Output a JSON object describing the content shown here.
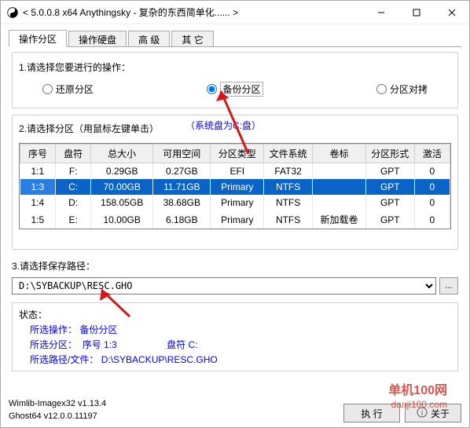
{
  "window": {
    "title": "< 5.0.0.8 x64 Anythingsky - 复杂的东西简单化...... >"
  },
  "tabs": {
    "t0": "操作分区",
    "t1": "操作硬盘",
    "t2": "高 级",
    "t3": "其 它"
  },
  "section1": {
    "label": "1.请选择您要进行的操作：",
    "opt_restore": "还原分区",
    "opt_backup": "备份分区",
    "opt_copy": "分区对拷"
  },
  "section2": {
    "label": "2.请选择分区（用鼠标左键单击）",
    "sysdisk": "（系统盘为C:盘）",
    "headers": {
      "idx": "序号",
      "drv": "盘符",
      "total": "总大小",
      "free": "可用空间",
      "type": "分区类型",
      "fs": "文件系统",
      "vol": "卷标",
      "scheme": "分区形式",
      "act": "激活"
    },
    "rows": [
      {
        "idx": "1:1",
        "drv": "F:",
        "total": "0.29GB",
        "free": "0.27GB",
        "type": "EFI",
        "fs": "FAT32",
        "vol": "",
        "scheme": "GPT",
        "act": "0"
      },
      {
        "idx": "1:3",
        "drv": "C:",
        "total": "70.00GB",
        "free": "11.71GB",
        "type": "Primary",
        "fs": "NTFS",
        "vol": "",
        "scheme": "GPT",
        "act": "0"
      },
      {
        "idx": "1:4",
        "drv": "D:",
        "total": "158.05GB",
        "free": "38.68GB",
        "type": "Primary",
        "fs": "NTFS",
        "vol": "",
        "scheme": "GPT",
        "act": "0"
      },
      {
        "idx": "1:5",
        "drv": "E:",
        "total": "10.00GB",
        "free": "6.18GB",
        "type": "Primary",
        "fs": "NTFS",
        "vol": "新加载卷",
        "scheme": "GPT",
        "act": "0"
      }
    ]
  },
  "section3": {
    "label": "3.请选择保存路径：",
    "path": "D:\\SYBACKUP\\RESC.GHO",
    "browse": "..."
  },
  "status": {
    "label": "状态：",
    "op_k": "所选操作：",
    "op_v": "备份分区",
    "part_k": "所选分区：",
    "part_idx_k": "序号",
    "part_idx_v": "1:3",
    "part_drv_k": "盘符",
    "part_drv_v": "C:",
    "path_k": "所选路径/文件：",
    "path_v": "D:\\SYBACKUP\\RESC.GHO"
  },
  "footer": {
    "ver1": "Wimlib-Imagex32 v1.13.4",
    "ver2": "Ghost64 v12.0.0.11197",
    "btn_exec": "执 行",
    "btn_about": "关于"
  },
  "watermark": {
    "cn": "单机100网",
    "en": "danji100.com"
  }
}
